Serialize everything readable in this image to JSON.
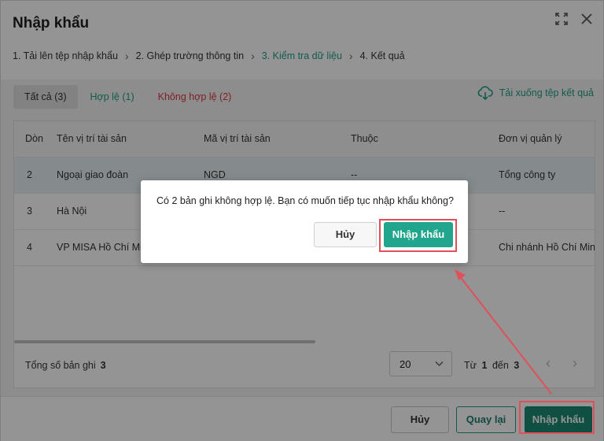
{
  "dialog": {
    "title": "Nhập khẩu",
    "expand_icon": "expand-icon",
    "close_icon": "close-icon"
  },
  "steps": [
    {
      "label": "1. Tải lên tệp nhập khẩu",
      "active": false
    },
    {
      "label": "2. Ghép trường thông tin",
      "active": false
    },
    {
      "label": "3. Kiểm tra dữ liệu",
      "active": true
    },
    {
      "label": "4. Kết quả",
      "active": false
    }
  ],
  "filters": {
    "all": "Tất cả (3)",
    "valid": "Hợp lệ (1)",
    "invalid": "Không hợp lệ (2)"
  },
  "download_label": "Tải xuống tệp kết quả",
  "table": {
    "columns": [
      "Dòn",
      "Tên vị trí tài sản",
      "Mã vị trí tài sản",
      "Thuộc",
      "Đơn vị quản lý"
    ],
    "rows": [
      [
        "2",
        "Ngoại giao đoàn",
        "NGD",
        "--",
        "Tổng công ty"
      ],
      [
        "3",
        "Hà Nội",
        "",
        "",
        "--"
      ],
      [
        "4",
        "VP MISA Hồ Chí Minh",
        "",
        "",
        "Chi nhánh Hồ Chí Minh"
      ]
    ]
  },
  "footer": {
    "total_label": "Tổng số bản ghi",
    "total_value": "3",
    "page_size": "20",
    "range_from_label": "Từ",
    "range_from": "1",
    "range_to_label": "đến",
    "range_to": "3"
  },
  "buttons": {
    "cancel": "Hủy",
    "back": "Quay lại",
    "import": "Nhập khẩu"
  },
  "confirm": {
    "message": "Có 2 bản ghi không hợp lệ. Bạn có muốn tiếp tục nhập khẩu không?",
    "cancel": "Hủy",
    "import": "Nhập khẩu"
  },
  "colors": {
    "accent": "#1f9d86",
    "danger": "#d9363e",
    "highlight": "#e0505a"
  }
}
